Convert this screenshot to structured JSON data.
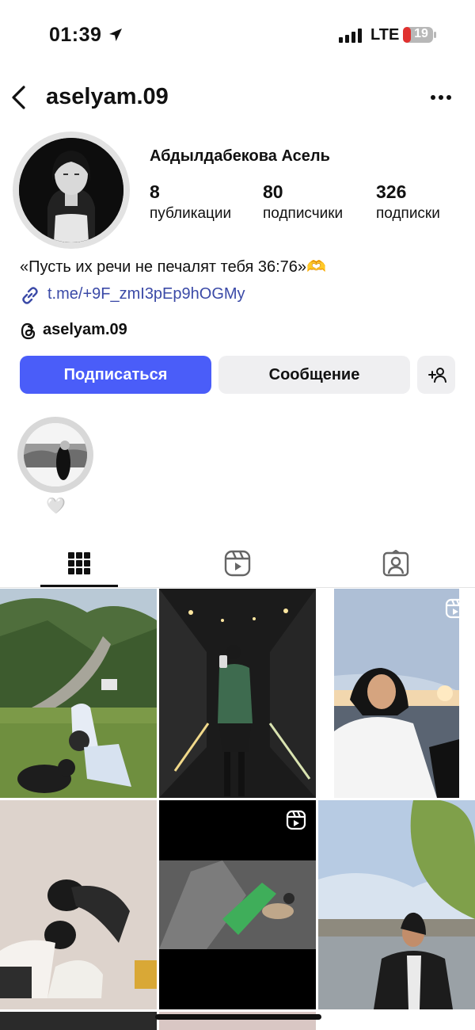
{
  "status_bar": {
    "time": "01:39",
    "network": "LTE",
    "battery": "19"
  },
  "header": {
    "username": "aselyam.09"
  },
  "profile": {
    "full_name": "Абдылдабекова Асель",
    "stats": [
      {
        "value": "8",
        "label": "публикации"
      },
      {
        "value": "80",
        "label": "подписчики"
      },
      {
        "value": "326",
        "label": "подписки"
      }
    ],
    "bio": "«Пусть их речи не печалят тебя 36:76»🫶",
    "link": "t.me/+9F_zmI3pEp9hOGMy",
    "threads_handle": "aselyam.09"
  },
  "actions": {
    "follow": "Подписаться",
    "message": "Сообщение"
  },
  "highlight": {
    "label": "🤍"
  },
  "tabs": [
    "grid-icon",
    "reels-icon",
    "tagged-icon"
  ],
  "colors": {
    "follow_button": "#4a5df9",
    "link": "#3b4aa7",
    "secondary_button": "#efeff1"
  }
}
